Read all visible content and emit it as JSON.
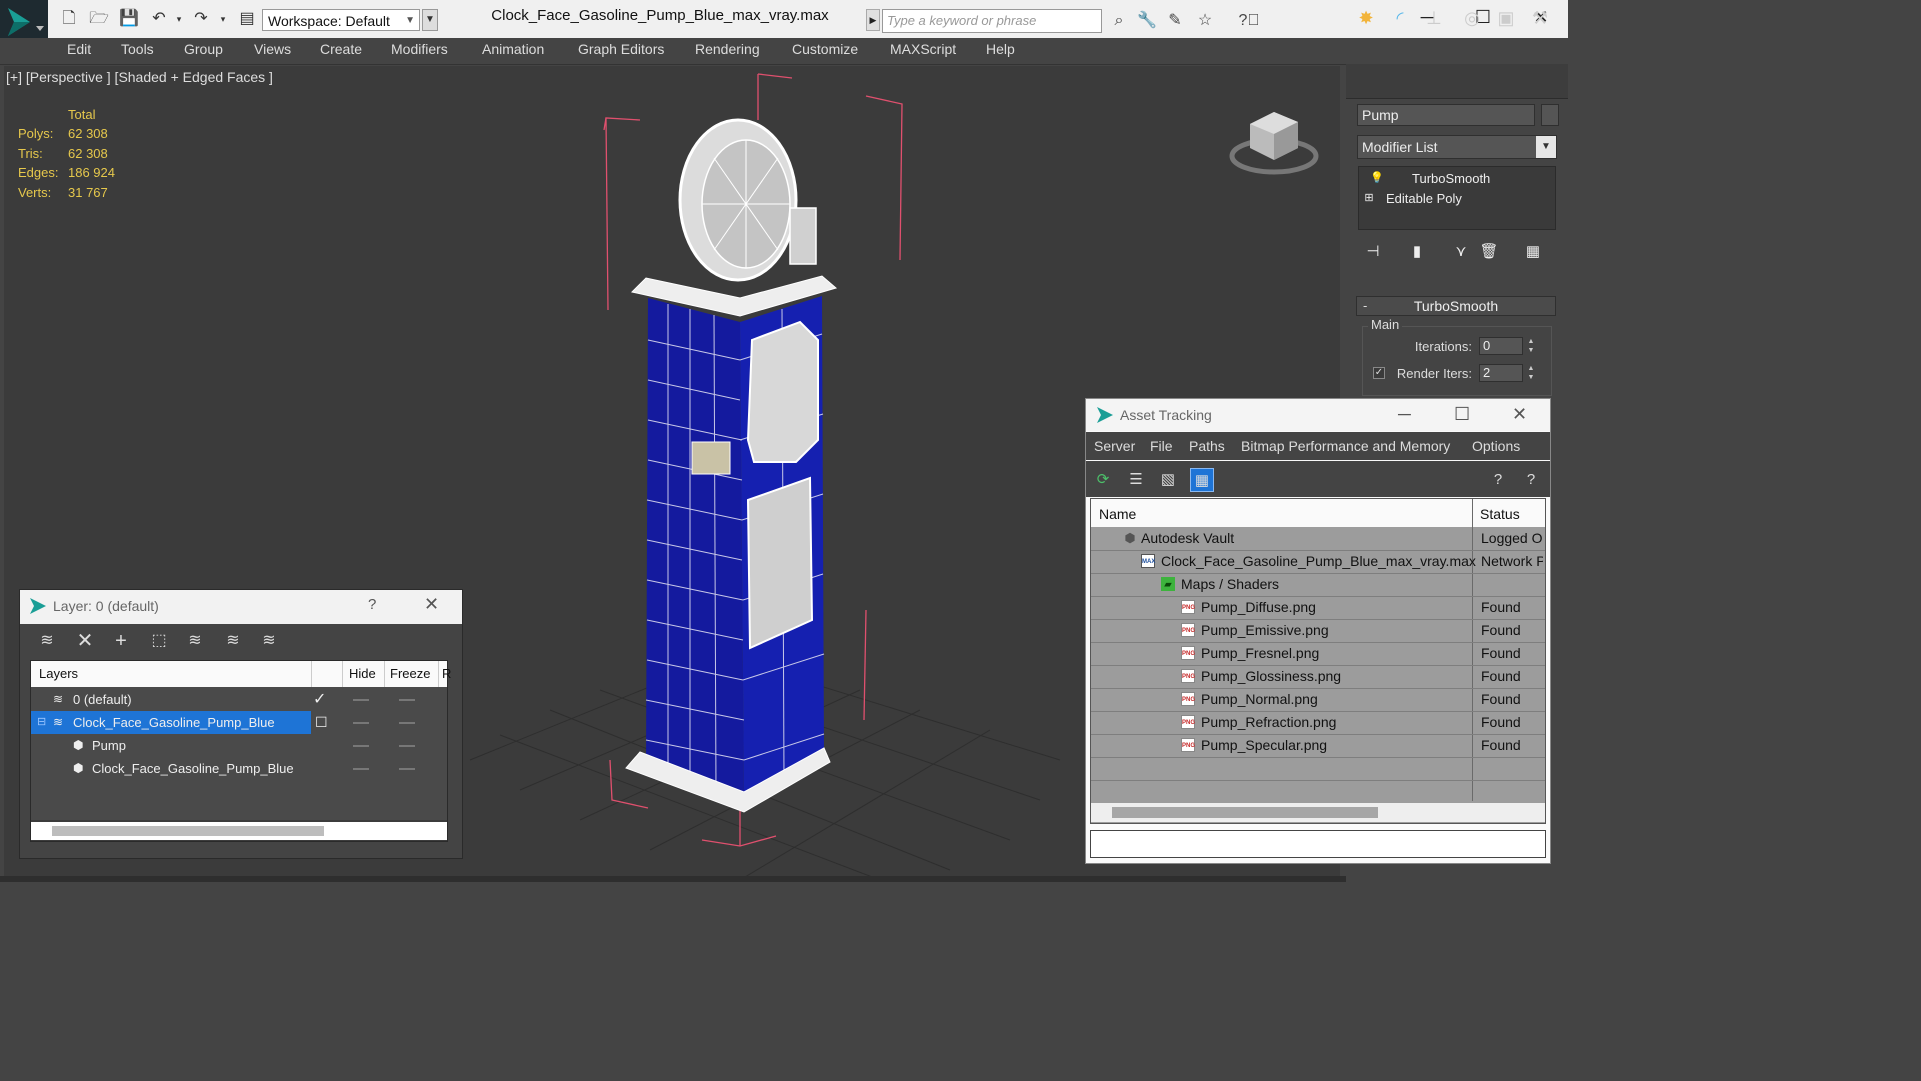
{
  "titlebar": {
    "workspace": "Workspace: Default",
    "title": "Clock_Face_Gasoline_Pump_Blue_max_vray.max",
    "search_placeholder": "Type a keyword or phrase"
  },
  "menu": [
    "Edit",
    "Tools",
    "Group",
    "Views",
    "Create",
    "Modifiers",
    "Animation",
    "Graph Editors",
    "Rendering",
    "Customize",
    "MAXScript",
    "Help"
  ],
  "viewport": {
    "label": "[+] [Perspective ] [Shaded + Edged Faces ]",
    "stats": {
      "total_label": "Total",
      "rows": [
        {
          "label": "Polys:",
          "value": "62 308"
        },
        {
          "label": "Tris:",
          "value": "62 308"
        },
        {
          "label": "Edges:",
          "value": "186 924"
        },
        {
          "label": "Verts:",
          "value": "31 767"
        }
      ]
    }
  },
  "command_panel": {
    "object_name": "Pump",
    "modifier_list": "Modifier List",
    "stack": [
      "TurboSmooth",
      "Editable Poly"
    ],
    "rollout_title": "TurboSmooth",
    "group_label": "Main",
    "iterations_label": "Iterations:",
    "iterations_value": "0",
    "render_iters_label": "Render Iters:",
    "render_iters_value": "2"
  },
  "layer_dialog": {
    "title": "Layer: 0 (default)",
    "help": "?",
    "columns": [
      "Layers",
      "Hide",
      "Freeze",
      "R"
    ],
    "rows": [
      {
        "name": "0 (default)"
      },
      {
        "name": "Clock_Face_Gasoline_Pump_Blue"
      },
      {
        "name": "Pump"
      },
      {
        "name": "Clock_Face_Gasoline_Pump_Blue"
      }
    ]
  },
  "asset_tracking": {
    "title": "Asset Tracking",
    "menu": [
      "Server",
      "File",
      "Paths",
      "Bitmap Performance and Memory",
      "Options"
    ],
    "columns": [
      "Name",
      "Status"
    ],
    "rows": [
      {
        "name": "Autodesk Vault",
        "status": "Logged Out"
      },
      {
        "name": "Clock_Face_Gasoline_Pump_Blue_max_vray.max",
        "status": "Network Path"
      },
      {
        "name": "Maps / Shaders",
        "status": ""
      },
      {
        "name": "Pump_Diffuse.png",
        "status": "Found"
      },
      {
        "name": "Pump_Emissive.png",
        "status": "Found"
      },
      {
        "name": "Pump_Fresnel.png",
        "status": "Found"
      },
      {
        "name": "Pump_Glossiness.png",
        "status": "Found"
      },
      {
        "name": "Pump_Normal.png",
        "status": "Found"
      },
      {
        "name": "Pump_Refraction.png",
        "status": "Found"
      },
      {
        "name": "Pump_Specular.png",
        "status": "Found"
      }
    ],
    "file_icon": "PNG",
    "max_icon": "MAX"
  },
  "colors": {
    "pump_blue": "#141a9e",
    "selection_blue": "#1e74d6",
    "stat_yellow": "#e6c84c",
    "bbox_pink": "#e0506e"
  }
}
